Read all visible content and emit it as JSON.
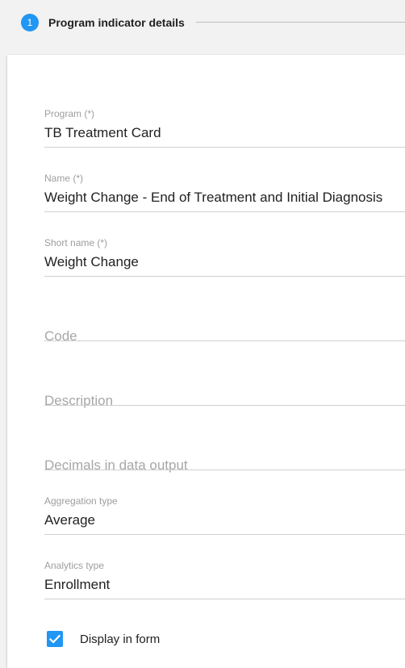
{
  "stepper": {
    "step_number": "1",
    "step_label": "Program indicator details",
    "accent_color": "#2196f3"
  },
  "form": {
    "program": {
      "label": "Program (*)",
      "value": "TB Treatment Card"
    },
    "name": {
      "label": "Name (*)",
      "value": "Weight Change - End of Treatment and Initial Diagnosis"
    },
    "short_name": {
      "label": "Short name (*)",
      "value": "Weight Change"
    },
    "code": {
      "placeholder": "Code",
      "value": ""
    },
    "description": {
      "placeholder": "Description",
      "value": ""
    },
    "decimals": {
      "placeholder": "Decimals in data output",
      "value": ""
    },
    "aggregation_type": {
      "label": "Aggregation type",
      "value": "Average"
    },
    "analytics_type": {
      "label": "Analytics type",
      "value": "Enrollment"
    },
    "display_in_form": {
      "label": "Display in form",
      "checked": true
    }
  }
}
